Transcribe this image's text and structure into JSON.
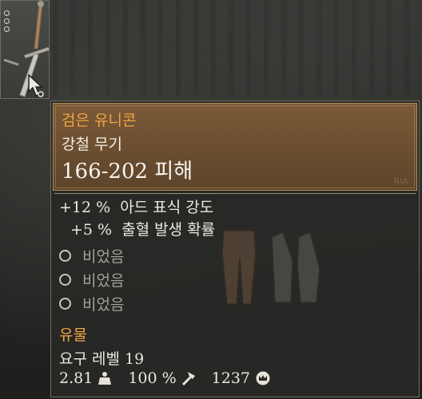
{
  "item": {
    "name": "검은 유니콘",
    "type": "강철 무기",
    "damage": "166-202 피해",
    "watermark": "RIA"
  },
  "stats": [
    "+12 %  아드 표식 강도",
    "+5 %  출혈 발생 확률"
  ],
  "sockets": [
    "비었음",
    "비었음",
    "비었음"
  ],
  "rarity": "유물",
  "requirement": "요구 레벨 19",
  "footer": {
    "weight": "2.81",
    "weight_icon": "weight-icon",
    "durability": "100 %",
    "durability_icon": "hammer-icon",
    "price": "1237",
    "price_icon": "crown-coin-icon"
  },
  "colors": {
    "rarity_accent": "#f0a545",
    "header_bg": "#6b4e30",
    "tooltip_bg": "#282826"
  }
}
